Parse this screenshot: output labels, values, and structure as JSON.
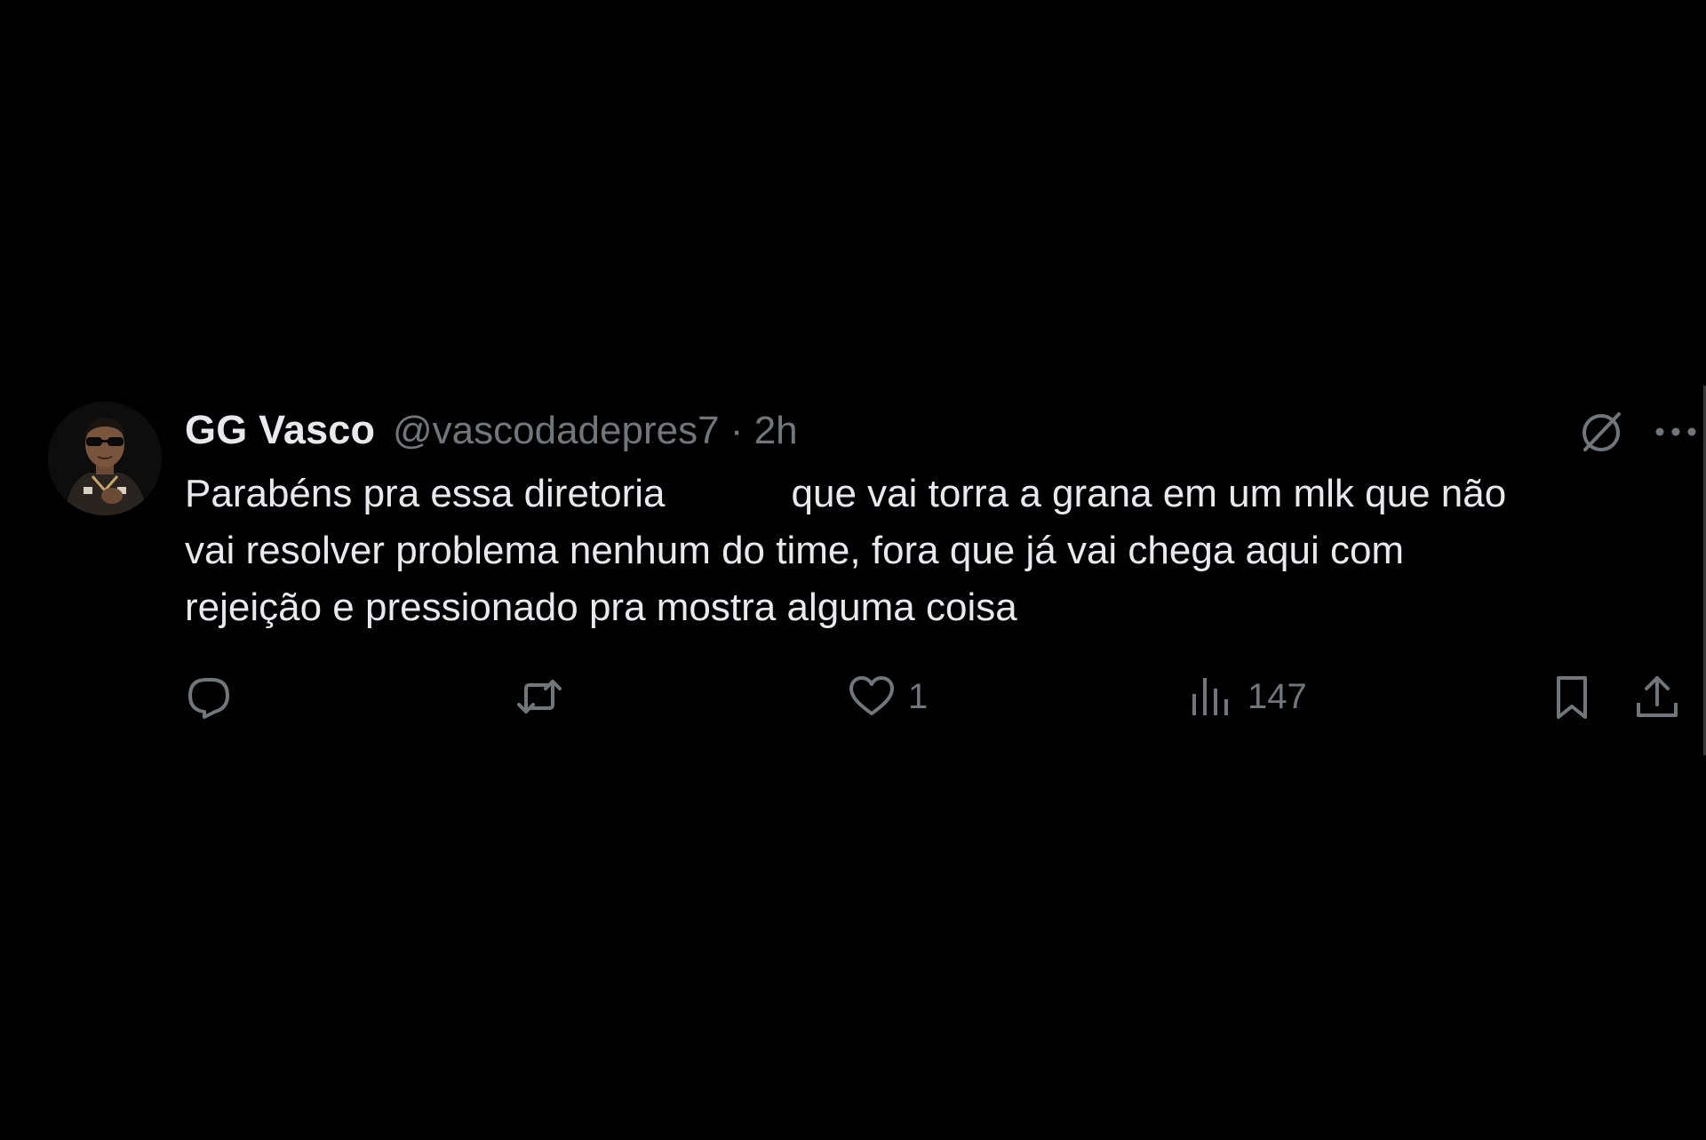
{
  "tweet": {
    "display_name": "GG Vasco",
    "handle": "@vascodadepres7",
    "separator": "·",
    "time": "2h",
    "text_lines": [
      "Parabéns pra essa diretoria",
      "que vai torra a grana em um mlk que não",
      "vai resolver problema nenhum do time, fora que já vai chega aqui com",
      "rejeição e pressionado pra mostra alguma coisa"
    ],
    "likes": "1",
    "views": "147"
  },
  "icons": {
    "avatar": "avatar",
    "grok": "grok-icon",
    "more": "more-icon",
    "reply": "reply-icon",
    "repost": "repost-icon",
    "like": "heart-icon",
    "views": "views-chart-icon",
    "bookmark": "bookmark-icon",
    "share": "share-icon"
  },
  "colors": {
    "background": "#000000",
    "primary_text": "#e7e9ea",
    "secondary_text": "#71767b"
  }
}
